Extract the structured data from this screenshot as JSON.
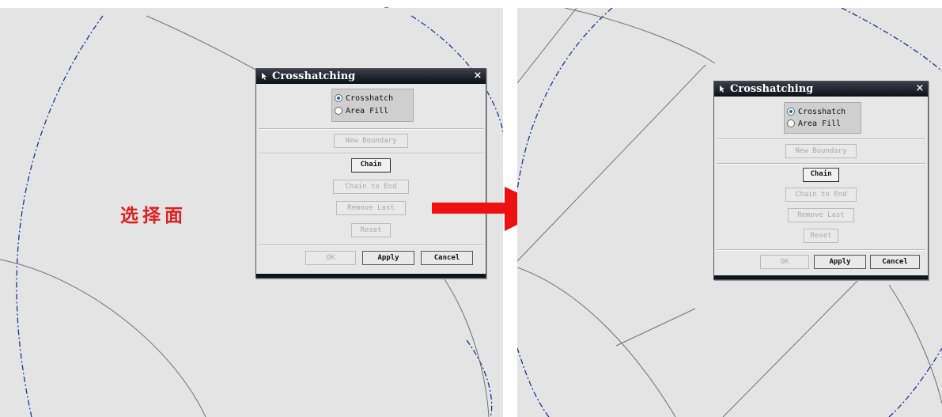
{
  "annotation": {
    "text": "选择面",
    "color": "#e02020"
  },
  "top_mark": "_",
  "dialogs": [
    {
      "title": "Crosshatching",
      "close_glyph": "×",
      "radio": {
        "options": [
          {
            "label": "Crosshatch",
            "selected": true
          },
          {
            "label": "Area Fill",
            "selected": false
          }
        ]
      },
      "buttons": {
        "new_boundary": "New Boundary",
        "chain": "Chain",
        "chain_to_end": "Chain to End",
        "remove_last": "Remove Last",
        "reset": "Reset",
        "ok": "OK",
        "apply": "Apply",
        "cancel": "Cancel"
      }
    },
    {
      "title": "Crosshatching",
      "close_glyph": "×",
      "radio": {
        "options": [
          {
            "label": "Crosshatch",
            "selected": true
          },
          {
            "label": "Area Fill",
            "selected": false
          }
        ]
      },
      "buttons": {
        "new_boundary": "New Boundary",
        "chain": "Chain",
        "chain_to_end": "Chain to End",
        "remove_last": "Remove Last",
        "reset": "Reset",
        "ok": "OK",
        "apply": "Apply",
        "cancel": "Cancel"
      }
    }
  ],
  "colors": {
    "canvas": "#e4e4e4",
    "circle_dashed": "#2a2a9a",
    "arc_lines": "#707070",
    "arrow": "#ee1111",
    "title_bar": "#0c0f16"
  }
}
